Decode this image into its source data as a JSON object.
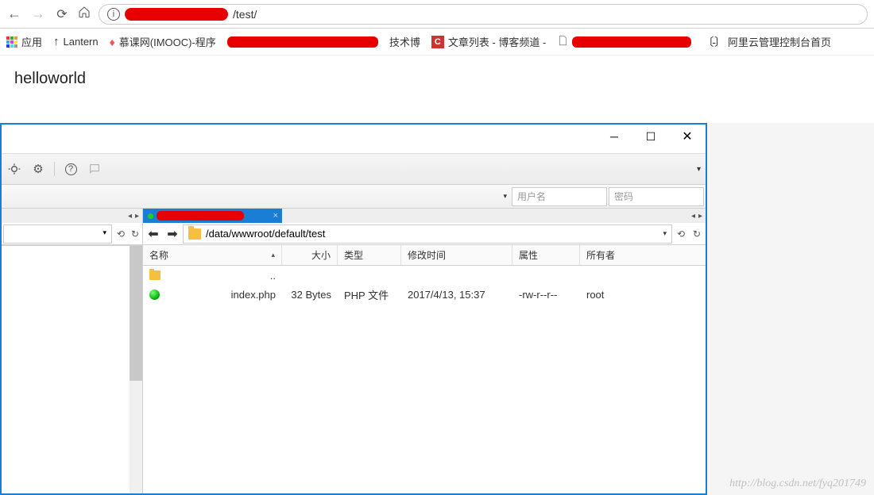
{
  "browser": {
    "url_suffix": "/test/",
    "bookmarks": {
      "apps": "应用",
      "lantern": "Lantern",
      "imooc": "慕课网(IMOOC)-程序",
      "tech_suffix": "技术博",
      "csdn": "文章列表 - 博客频道 -",
      "aliyun": "阿里云管理控制台首页"
    }
  },
  "page": {
    "body_text": "helloworld"
  },
  "ftp": {
    "quickconnect": {
      "user_ph": "用户名",
      "pass_ph": "密码"
    },
    "remote_path": "/data/wwwroot/default/test",
    "columns": {
      "name": "名称",
      "size": "大小",
      "type": "类型",
      "modified": "修改时间",
      "attrs": "属性",
      "owner": "所有者"
    },
    "parent_row": "..",
    "files": [
      {
        "name": "index.php",
        "size": "32 Bytes",
        "type": "PHP 文件",
        "modified": "2017/4/13, 15:37",
        "attrs": "-rw-r--r--",
        "owner": "root"
      }
    ]
  },
  "watermark": "http://blog.csdn.net/fyq201749"
}
